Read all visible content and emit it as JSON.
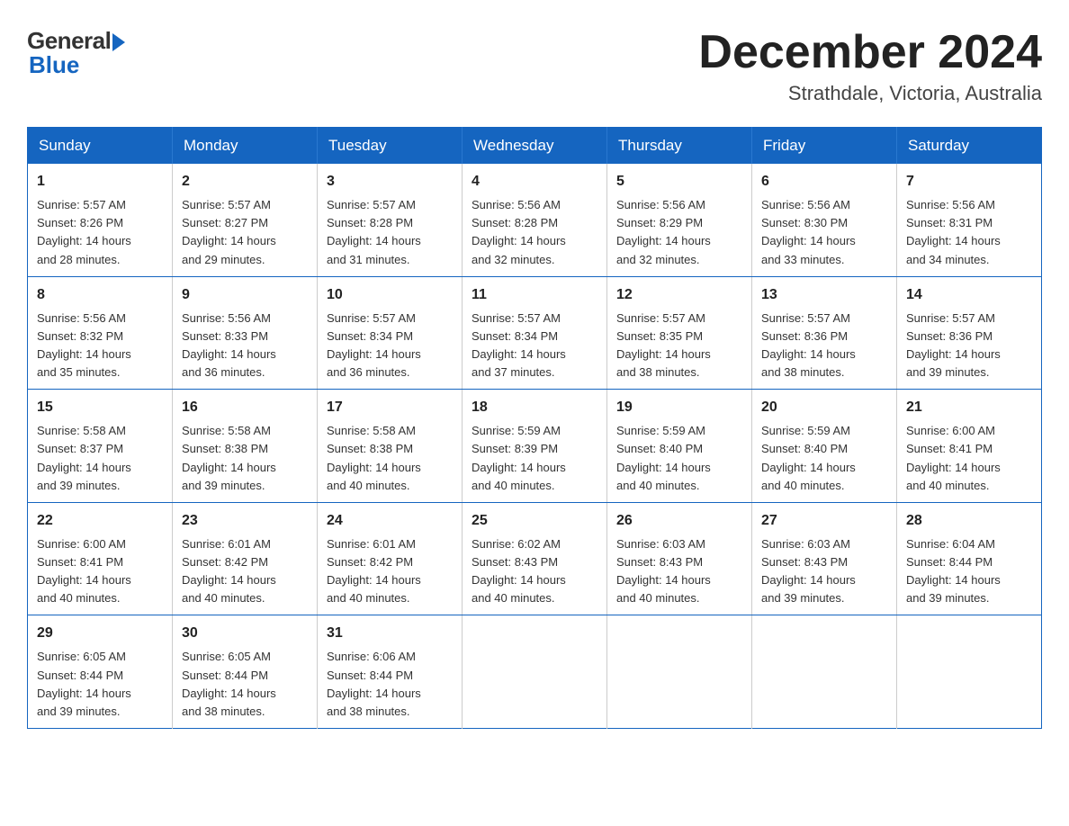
{
  "header": {
    "logo_general": "General",
    "logo_blue": "Blue",
    "month_title": "December 2024",
    "location": "Strathdale, Victoria, Australia"
  },
  "days_of_week": [
    "Sunday",
    "Monday",
    "Tuesday",
    "Wednesday",
    "Thursday",
    "Friday",
    "Saturday"
  ],
  "weeks": [
    [
      {
        "day": "1",
        "sunrise": "5:57 AM",
        "sunset": "8:26 PM",
        "daylight": "14 hours and 28 minutes."
      },
      {
        "day": "2",
        "sunrise": "5:57 AM",
        "sunset": "8:27 PM",
        "daylight": "14 hours and 29 minutes."
      },
      {
        "day": "3",
        "sunrise": "5:57 AM",
        "sunset": "8:28 PM",
        "daylight": "14 hours and 31 minutes."
      },
      {
        "day": "4",
        "sunrise": "5:56 AM",
        "sunset": "8:28 PM",
        "daylight": "14 hours and 32 minutes."
      },
      {
        "day": "5",
        "sunrise": "5:56 AM",
        "sunset": "8:29 PM",
        "daylight": "14 hours and 32 minutes."
      },
      {
        "day": "6",
        "sunrise": "5:56 AM",
        "sunset": "8:30 PM",
        "daylight": "14 hours and 33 minutes."
      },
      {
        "day": "7",
        "sunrise": "5:56 AM",
        "sunset": "8:31 PM",
        "daylight": "14 hours and 34 minutes."
      }
    ],
    [
      {
        "day": "8",
        "sunrise": "5:56 AM",
        "sunset": "8:32 PM",
        "daylight": "14 hours and 35 minutes."
      },
      {
        "day": "9",
        "sunrise": "5:56 AM",
        "sunset": "8:33 PM",
        "daylight": "14 hours and 36 minutes."
      },
      {
        "day": "10",
        "sunrise": "5:57 AM",
        "sunset": "8:34 PM",
        "daylight": "14 hours and 36 minutes."
      },
      {
        "day": "11",
        "sunrise": "5:57 AM",
        "sunset": "8:34 PM",
        "daylight": "14 hours and 37 minutes."
      },
      {
        "day": "12",
        "sunrise": "5:57 AM",
        "sunset": "8:35 PM",
        "daylight": "14 hours and 38 minutes."
      },
      {
        "day": "13",
        "sunrise": "5:57 AM",
        "sunset": "8:36 PM",
        "daylight": "14 hours and 38 minutes."
      },
      {
        "day": "14",
        "sunrise": "5:57 AM",
        "sunset": "8:36 PM",
        "daylight": "14 hours and 39 minutes."
      }
    ],
    [
      {
        "day": "15",
        "sunrise": "5:58 AM",
        "sunset": "8:37 PM",
        "daylight": "14 hours and 39 minutes."
      },
      {
        "day": "16",
        "sunrise": "5:58 AM",
        "sunset": "8:38 PM",
        "daylight": "14 hours and 39 minutes."
      },
      {
        "day": "17",
        "sunrise": "5:58 AM",
        "sunset": "8:38 PM",
        "daylight": "14 hours and 40 minutes."
      },
      {
        "day": "18",
        "sunrise": "5:59 AM",
        "sunset": "8:39 PM",
        "daylight": "14 hours and 40 minutes."
      },
      {
        "day": "19",
        "sunrise": "5:59 AM",
        "sunset": "8:40 PM",
        "daylight": "14 hours and 40 minutes."
      },
      {
        "day": "20",
        "sunrise": "5:59 AM",
        "sunset": "8:40 PM",
        "daylight": "14 hours and 40 minutes."
      },
      {
        "day": "21",
        "sunrise": "6:00 AM",
        "sunset": "8:41 PM",
        "daylight": "14 hours and 40 minutes."
      }
    ],
    [
      {
        "day": "22",
        "sunrise": "6:00 AM",
        "sunset": "8:41 PM",
        "daylight": "14 hours and 40 minutes."
      },
      {
        "day": "23",
        "sunrise": "6:01 AM",
        "sunset": "8:42 PM",
        "daylight": "14 hours and 40 minutes."
      },
      {
        "day": "24",
        "sunrise": "6:01 AM",
        "sunset": "8:42 PM",
        "daylight": "14 hours and 40 minutes."
      },
      {
        "day": "25",
        "sunrise": "6:02 AM",
        "sunset": "8:43 PM",
        "daylight": "14 hours and 40 minutes."
      },
      {
        "day": "26",
        "sunrise": "6:03 AM",
        "sunset": "8:43 PM",
        "daylight": "14 hours and 40 minutes."
      },
      {
        "day": "27",
        "sunrise": "6:03 AM",
        "sunset": "8:43 PM",
        "daylight": "14 hours and 39 minutes."
      },
      {
        "day": "28",
        "sunrise": "6:04 AM",
        "sunset": "8:44 PM",
        "daylight": "14 hours and 39 minutes."
      }
    ],
    [
      {
        "day": "29",
        "sunrise": "6:05 AM",
        "sunset": "8:44 PM",
        "daylight": "14 hours and 39 minutes."
      },
      {
        "day": "30",
        "sunrise": "6:05 AM",
        "sunset": "8:44 PM",
        "daylight": "14 hours and 38 minutes."
      },
      {
        "day": "31",
        "sunrise": "6:06 AM",
        "sunset": "8:44 PM",
        "daylight": "14 hours and 38 minutes."
      },
      null,
      null,
      null,
      null
    ]
  ],
  "labels": {
    "sunrise": "Sunrise:",
    "sunset": "Sunset:",
    "daylight": "Daylight:"
  }
}
